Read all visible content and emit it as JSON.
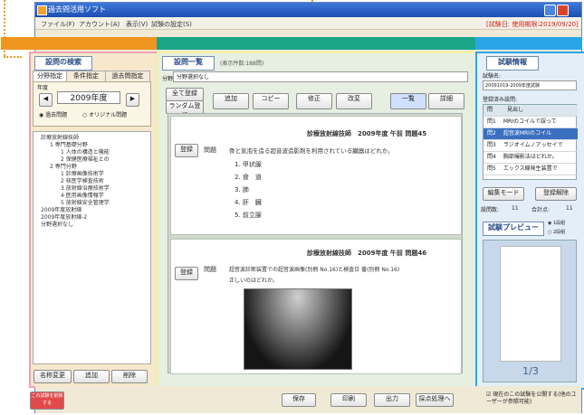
{
  "window": {
    "title": "過去問活用ソフト"
  },
  "menubar": {
    "items": [
      "ファイル(F)",
      "アカウント(A)",
      "表示(V)",
      "試験の設定(S)"
    ],
    "status": "[試験日: 使用期限:2019/09/20]"
  },
  "colors": {
    "left_accent": "#f0951e",
    "mid_accent": "#1aa586",
    "right_accent": "#2aa6e8",
    "left_frame": "#f4a0b4",
    "mid_frame": "#f1f1a0",
    "titlebar": "#1d4fb3"
  },
  "left": {
    "title": "設問の検索",
    "tabs": [
      "分野指定",
      "条件指定",
      "過去問指定"
    ],
    "year_label": "年度",
    "year": "2009年度",
    "radio_past": "過去問題",
    "radio_original": "オリジナル問題",
    "tree": [
      "診療放射線技師",
      "1 専門基礎分野",
      "1 人体の構造と機能",
      "2 保健医療福祉との",
      "2 専門分野",
      "1 診療画像技術学",
      "2 核医学検査技術",
      "3 放射線治療技術学",
      "4 医用画像情報学",
      "5 放射線安全管理学",
      "2009年度放射線",
      "2009年度放射線-2",
      "分野選択なし"
    ],
    "btn_rename": "名称変更",
    "btn_add": "追加",
    "btn_delete": "削除"
  },
  "middle": {
    "title": "設問一覧",
    "count": "(表示件数:188問)",
    "field_label": "分野",
    "field_value": "分野選択なし",
    "btn_all_register": "全て登録",
    "btn_random_register": "ランダム登録",
    "toolbar": [
      "追加",
      "コピー",
      "修正",
      "改変",
      "一覧",
      "詳細"
    ],
    "questions": [
      {
        "register": "登録",
        "header": "診療放射線技師　2009年度 午前 問題45",
        "label": "問題",
        "text": "骨と気泡を造る超音波造影剤を利用されている臓器はどれか。",
        "options": [
          "1. 甲状腺",
          "2. 食　道",
          "3. 肺",
          "4. 肝　臓",
          "5. 前立腺"
        ]
      },
      {
        "register": "登録",
        "header": "診療放射線技師　2009年度 午前 問題46",
        "label": "問題",
        "text": "超音波診断装置での超音波画像(別冊 No.16)と検査日 番(別冊 No.16)",
        "text2": "正しいのはどれか。"
      }
    ],
    "footer": {
      "save": "保存",
      "print": "印刷",
      "output": "出力",
      "grading": "採点処理へ"
    }
  },
  "right": {
    "title": "試験情報",
    "exam_name_label": "試験名:",
    "exam_name": "20091019-2009年度試験",
    "registered_label": "登録済み設問:",
    "list_header": [
      "問",
      "見出し"
    ],
    "list": [
      {
        "num": "問1",
        "text": "MRIのコイルで誤って",
        "selected": false
      },
      {
        "num": "問2",
        "text": "超音波MRIのコイル",
        "selected": true
      },
      {
        "num": "問3",
        "text": "ラジオイムノアッセイで",
        "selected": false
      },
      {
        "num": "問4",
        "text": "胸部撮影法はどれか。",
        "selected": false
      },
      {
        "num": "問5",
        "text": "エックス線発生装置で",
        "selected": false
      }
    ],
    "btn_edit_mode": "編集モード",
    "btn_release": "登録解除",
    "count_label": "設問数:",
    "count_value": "11",
    "total_label": "合計点:",
    "total_value": "11",
    "preview_title": "試験プレビュー",
    "radio1": "1段組",
    "radio2": "2段組",
    "page_indicator": "1/3",
    "note": "現在のこの試験を公開する(他のユーザーが参照可能)"
  },
  "bottom": {
    "action_button": "この試験を削除する"
  }
}
